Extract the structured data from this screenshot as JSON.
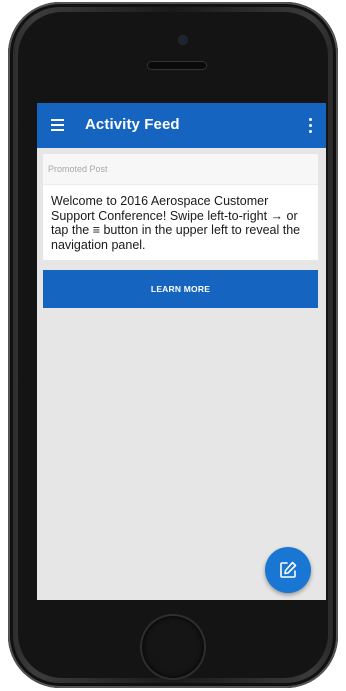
{
  "appbar": {
    "title": "Activity Feed",
    "menu_icon": "hamburger-menu-icon",
    "overflow_icon": "more-vert-icon",
    "color": "#1565c0"
  },
  "promoted_post": {
    "label": "Promoted Post",
    "body": "Welcome to 2016 Aerospace Customer Support Conference! Swipe left-to-right → or tap the ≡ button in the upper left to reveal the navigation panel.",
    "button_label": "LEARN MORE"
  },
  "fab": {
    "icon": "compose-edit-icon",
    "color": "#1976d2"
  },
  "background_color": "#e6e6e6"
}
